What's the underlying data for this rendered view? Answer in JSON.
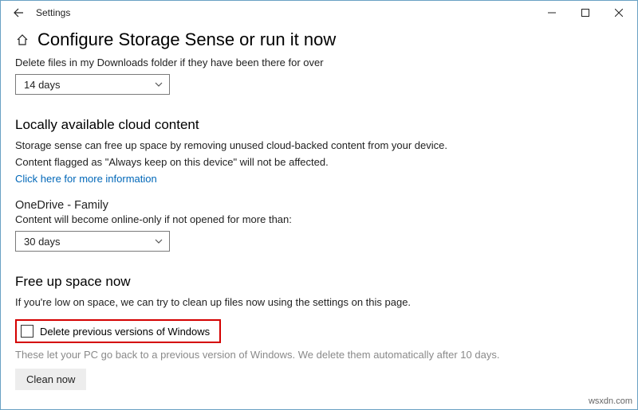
{
  "window": {
    "title": "Settings"
  },
  "header": {
    "title": "Configure Storage Sense or run it now"
  },
  "downloads": {
    "label": "Delete files in my Downloads folder if they have been there for over",
    "selected": "14 days"
  },
  "cloud": {
    "heading": "Locally available cloud content",
    "text1": "Storage sense can free up space by removing unused cloud-backed content from your device.",
    "text2": "Content flagged as \"Always keep on this device\" will not be affected.",
    "link": "Click here for more information"
  },
  "onedrive": {
    "title": "OneDrive - Family",
    "text": "Content will become online-only if not opened for more than:",
    "selected": "30 days"
  },
  "freeup": {
    "heading": "Free up space now",
    "text": "If you're low on space, we can try to clean up files now using the settings on this page.",
    "checkbox_label": "Delete previous versions of Windows",
    "help": "These let your PC go back to a previous version of Windows. We delete them automatically after 10 days.",
    "button": "Clean now"
  },
  "watermark": "wsxdn.com"
}
